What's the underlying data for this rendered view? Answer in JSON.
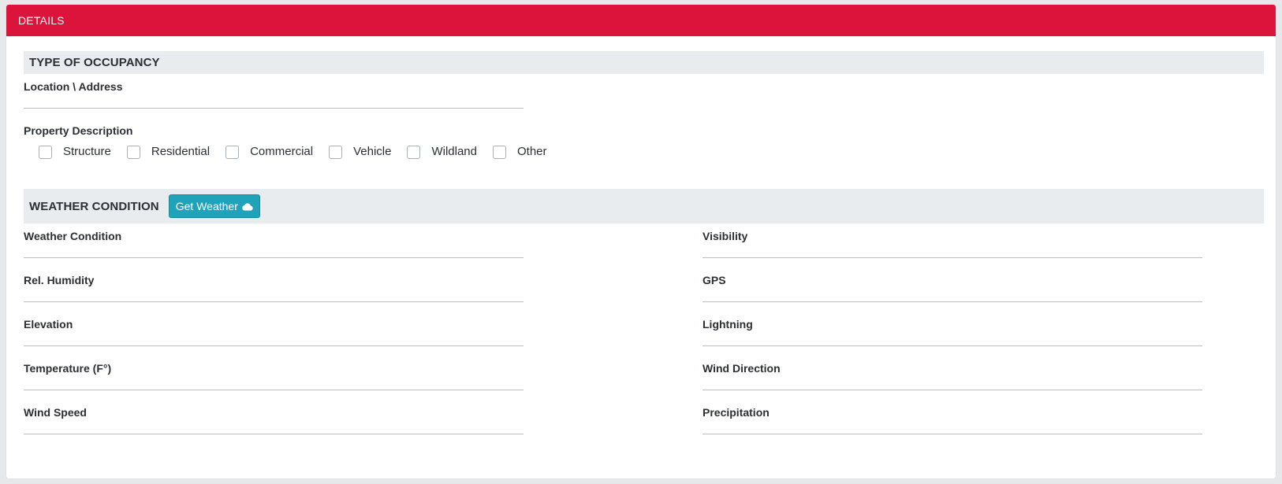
{
  "panel": {
    "title": "DETAILS"
  },
  "occupancy": {
    "section_title": "TYPE OF OCCUPANCY",
    "location_label": "Location \\ Address",
    "location_value": "",
    "property_label": "Property Description",
    "options": [
      "Structure",
      "Residential",
      "Commercial",
      "Vehicle",
      "Wildland",
      "Other"
    ]
  },
  "weather": {
    "section_title": "WEATHER CONDITION",
    "button_label": "Get Weather",
    "button_icon": "cloud-icon",
    "left_fields": [
      "Weather Condition",
      "Rel. Humidity",
      "Elevation",
      "Temperature (F°)",
      "Wind Speed"
    ],
    "right_fields": [
      "Visibility",
      "GPS",
      "Lightning",
      "Wind Direction",
      "Precipitation"
    ]
  },
  "colors": {
    "header": "#dc143c",
    "section_bar": "#e9ecef",
    "button": "#1fa2ba"
  }
}
